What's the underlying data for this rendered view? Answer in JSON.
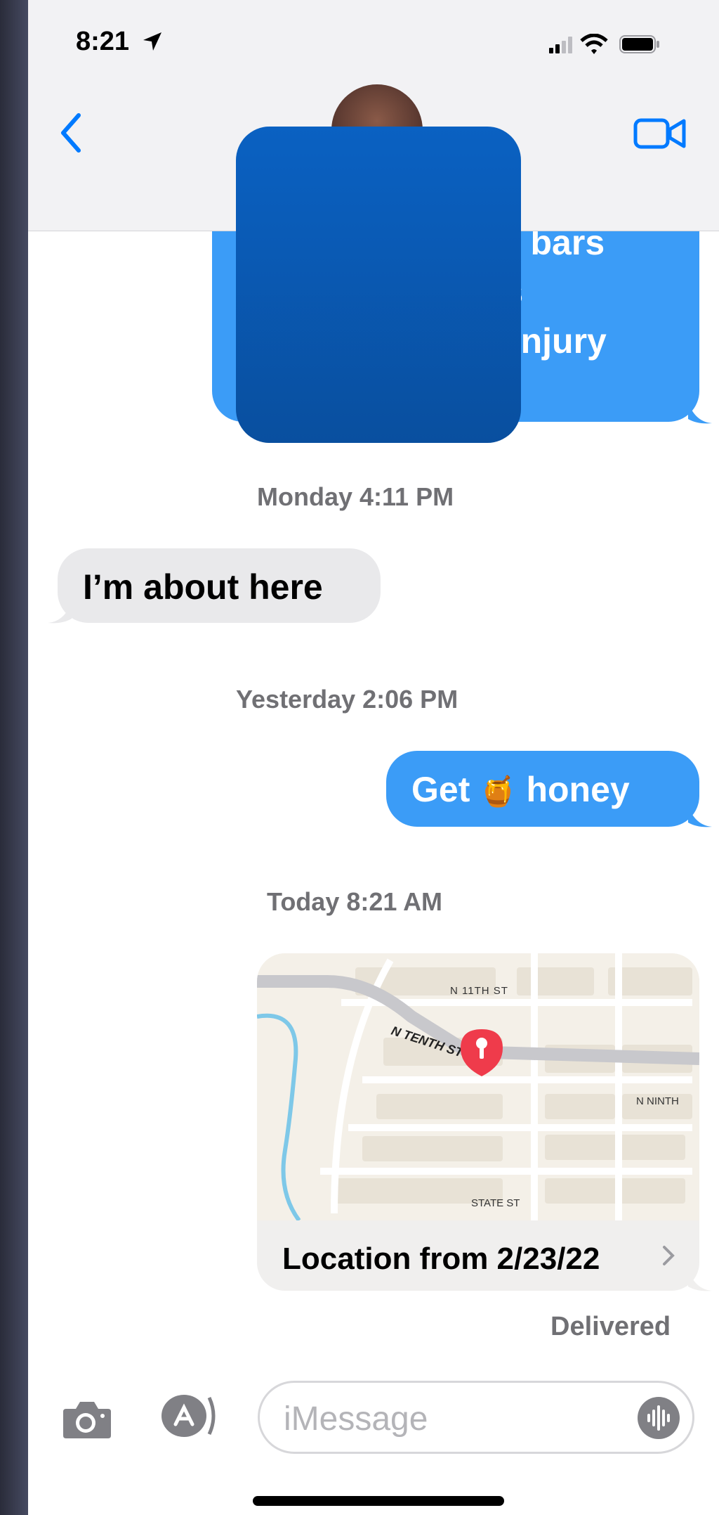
{
  "status_bar": {
    "time": "8:21"
  },
  "chat": {
    "partial_message_lines": [
      "ey bars",
      "r's",
      "y injury"
    ],
    "timestamps": [
      "Monday 4:11 PM",
      "Yesterday 2:06 PM",
      "Today 8:21 AM"
    ],
    "incoming_message": "I’m about here",
    "outgoing_message_prefix": "Get",
    "outgoing_emoji": "🍯",
    "outgoing_message_suffix": "honey",
    "map": {
      "street_labels": [
        "N 11TH ST",
        "N TENTH ST",
        "N NINTH",
        "STATE ST"
      ]
    },
    "location_caption": "Location from 2/23/22",
    "delivered_label": "Delivered"
  },
  "composer": {
    "placeholder": "iMessage"
  },
  "colors": {
    "accent": "#007aff",
    "outgoing_bubble": "#3b9cf7",
    "pin": "#ef3b4b"
  }
}
